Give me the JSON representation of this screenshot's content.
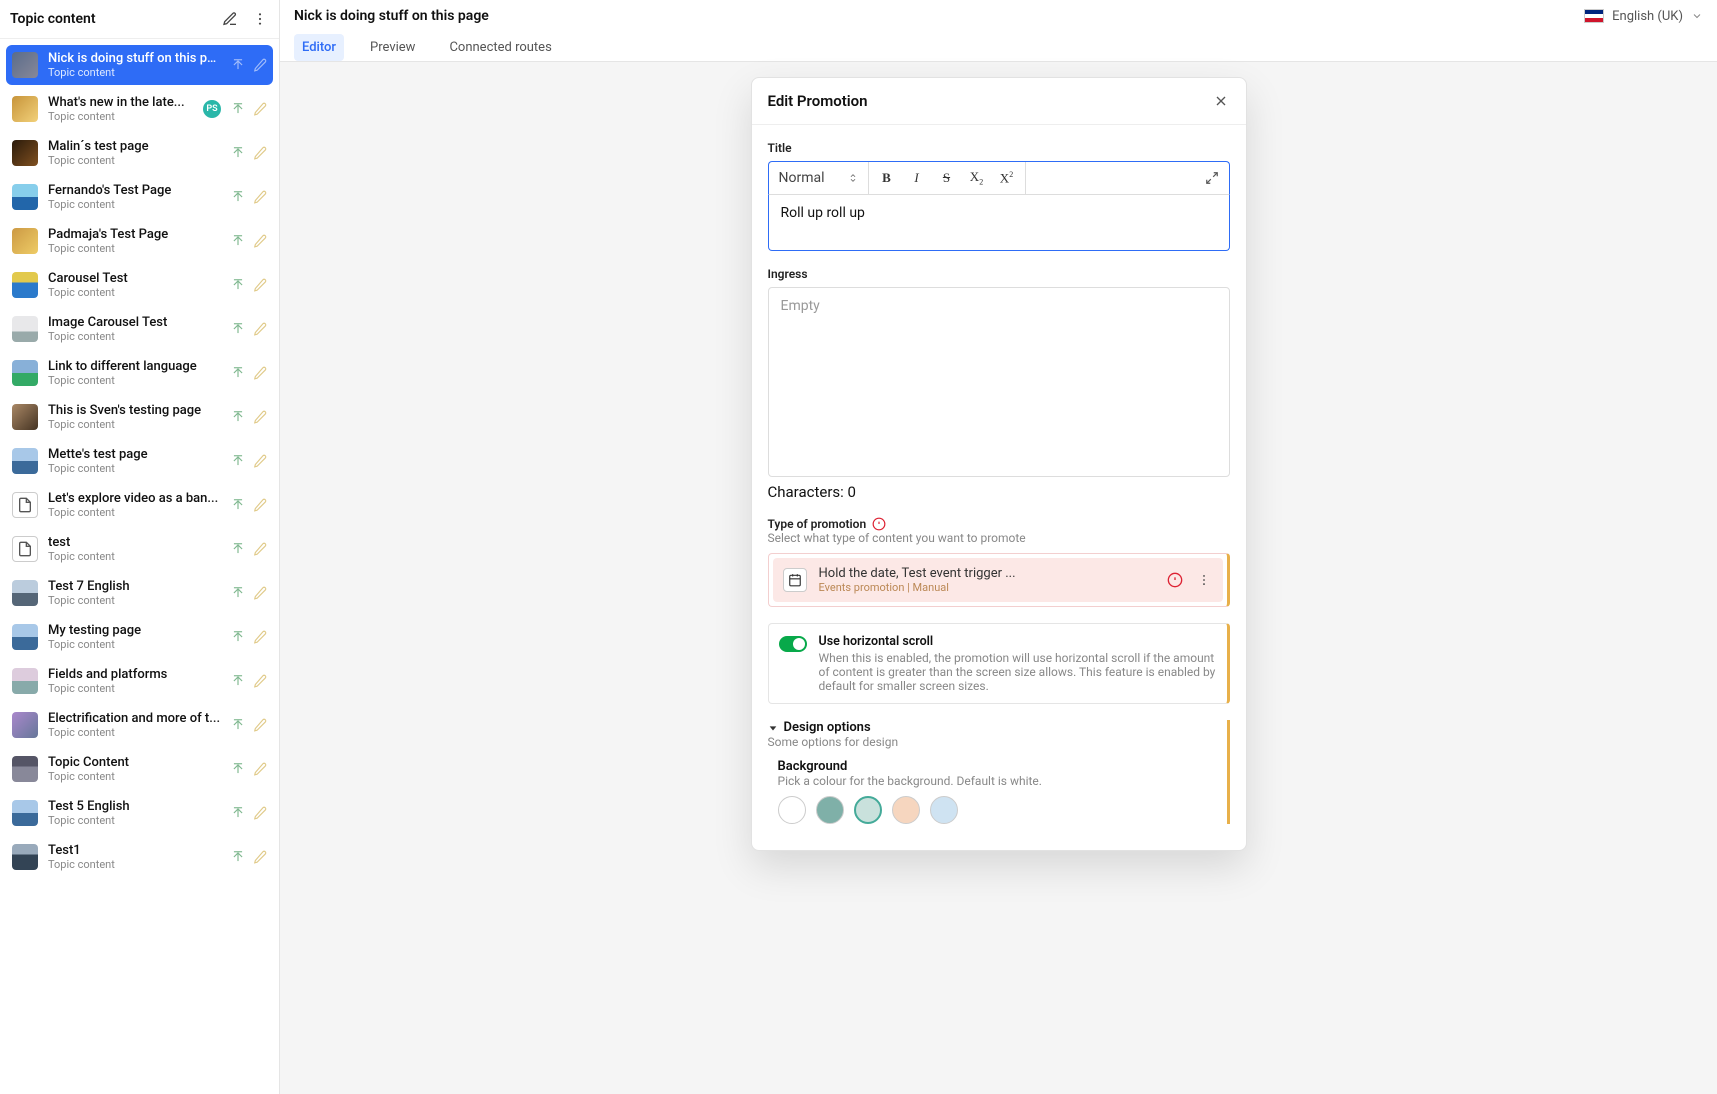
{
  "sidebar": {
    "title": "Topic content",
    "items": [
      {
        "title": "Nick is doing stuff on this pa...",
        "sub": "Topic content",
        "selected": true,
        "badge": null,
        "docIcon": false
      },
      {
        "title": "What's new in the late...",
        "sub": "Topic content",
        "badge": "PS",
        "docIcon": false
      },
      {
        "title": "Malin´s test page",
        "sub": "Topic content",
        "docIcon": false
      },
      {
        "title": "Fernando's Test Page",
        "sub": "Topic content",
        "docIcon": false
      },
      {
        "title": "Padmaja's Test Page",
        "sub": "Topic content",
        "docIcon": false
      },
      {
        "title": "Carousel Test",
        "sub": "Topic content",
        "docIcon": false
      },
      {
        "title": "Image Carousel Test",
        "sub": "Topic content",
        "docIcon": false
      },
      {
        "title": "Link to different language",
        "sub": "Topic content",
        "docIcon": false
      },
      {
        "title": "This is Sven's testing page",
        "sub": "Topic content",
        "docIcon": false
      },
      {
        "title": "Mette's test page",
        "sub": "Topic content",
        "docIcon": false
      },
      {
        "title": "Let's explore video as a ban...",
        "sub": "Topic content",
        "docIcon": true
      },
      {
        "title": "test",
        "sub": "Topic content",
        "docIcon": true
      },
      {
        "title": "Test 7 English",
        "sub": "Topic content",
        "docIcon": false
      },
      {
        "title": "My testing page",
        "sub": "Topic content",
        "docIcon": false
      },
      {
        "title": "Fields and platforms",
        "sub": "Topic content",
        "docIcon": false
      },
      {
        "title": "Electrification and more of t...",
        "sub": "Topic content",
        "docIcon": false
      },
      {
        "title": "Topic Content",
        "sub": "Topic content",
        "docIcon": false
      },
      {
        "title": "Test 5 English",
        "sub": "Topic content",
        "docIcon": false
      },
      {
        "title": "Test1",
        "sub": "Topic content",
        "docIcon": false
      }
    ]
  },
  "header": {
    "pageTitle": "Nick is doing stuff on this page",
    "language": "English (UK)",
    "tabs": [
      "Editor",
      "Preview",
      "Connected routes"
    ]
  },
  "modal": {
    "title": "Edit Promotion",
    "fields": {
      "titleLabel": "Title",
      "formatSelect": "Normal",
      "titleValue": "Roll up roll up",
      "ingressLabel": "Ingress",
      "ingressPlaceholder": "Empty",
      "charCount": "Characters: 0",
      "promoTypeLabel": "Type of promotion",
      "promoTypeHint": "Select what type of content you want to promote",
      "promoCard": {
        "title": "Hold the date, Test event trigger ...",
        "sub": "Events promotion | Manual"
      },
      "hscroll": {
        "label": "Use horizontal scroll",
        "desc": "When this is enabled, the promotion will use horizontal scroll if the amount of content is greater than the screen size allows. This feature is enabled by default for smaller screen sizes."
      },
      "design": {
        "header": "Design options",
        "hint": "Some options for design",
        "bgLabel": "Background",
        "bgHint": "Pick a colour for the background. Default is white.",
        "swatches": [
          "#ffffff",
          "#7fb0a8",
          "#c9e1dc",
          "#f6d6bf",
          "#cfe3f2"
        ]
      }
    }
  }
}
